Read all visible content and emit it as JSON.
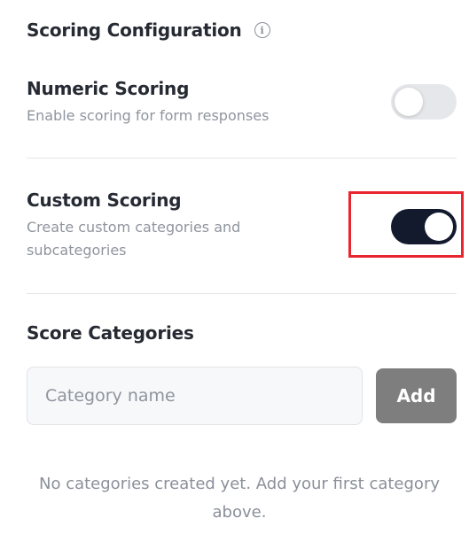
{
  "header": {
    "title": "Scoring Configuration",
    "info_icon": "info-icon"
  },
  "numeric_scoring": {
    "title": "Numeric Scoring",
    "description": "Enable scoring for form responses",
    "enabled": false
  },
  "custom_scoring": {
    "title": "Custom Scoring",
    "description": "Create custom categories and subcategories",
    "enabled": true
  },
  "score_categories": {
    "title": "Score Categories",
    "input_placeholder": "Category name",
    "input_value": "",
    "add_label": "Add",
    "empty_message": "No categories created yet. Add your first category above."
  },
  "colors": {
    "toggle_on": "#141a2e",
    "toggle_off": "#e6e7ea",
    "add_button": "#7e7e7e",
    "highlight": "#e8262f"
  }
}
